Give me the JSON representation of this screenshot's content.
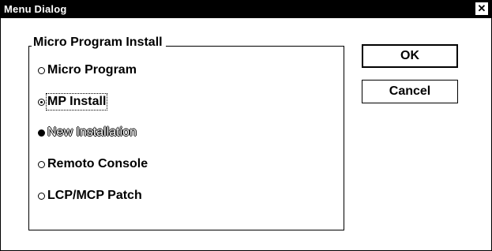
{
  "window": {
    "title": "Menu Dialog",
    "close_glyph": "✕"
  },
  "group": {
    "label": "Micro Program Install"
  },
  "options": [
    {
      "label": "Micro Program",
      "state": "unchecked"
    },
    {
      "label": "MP Install",
      "state": "checked"
    },
    {
      "label": "New Installation",
      "state": "disabled"
    },
    {
      "label": "Remoto Console",
      "state": "unchecked"
    },
    {
      "label": "LCP/MCP Patch",
      "state": "unchecked"
    }
  ],
  "buttons": {
    "ok": "OK",
    "cancel": "Cancel"
  }
}
